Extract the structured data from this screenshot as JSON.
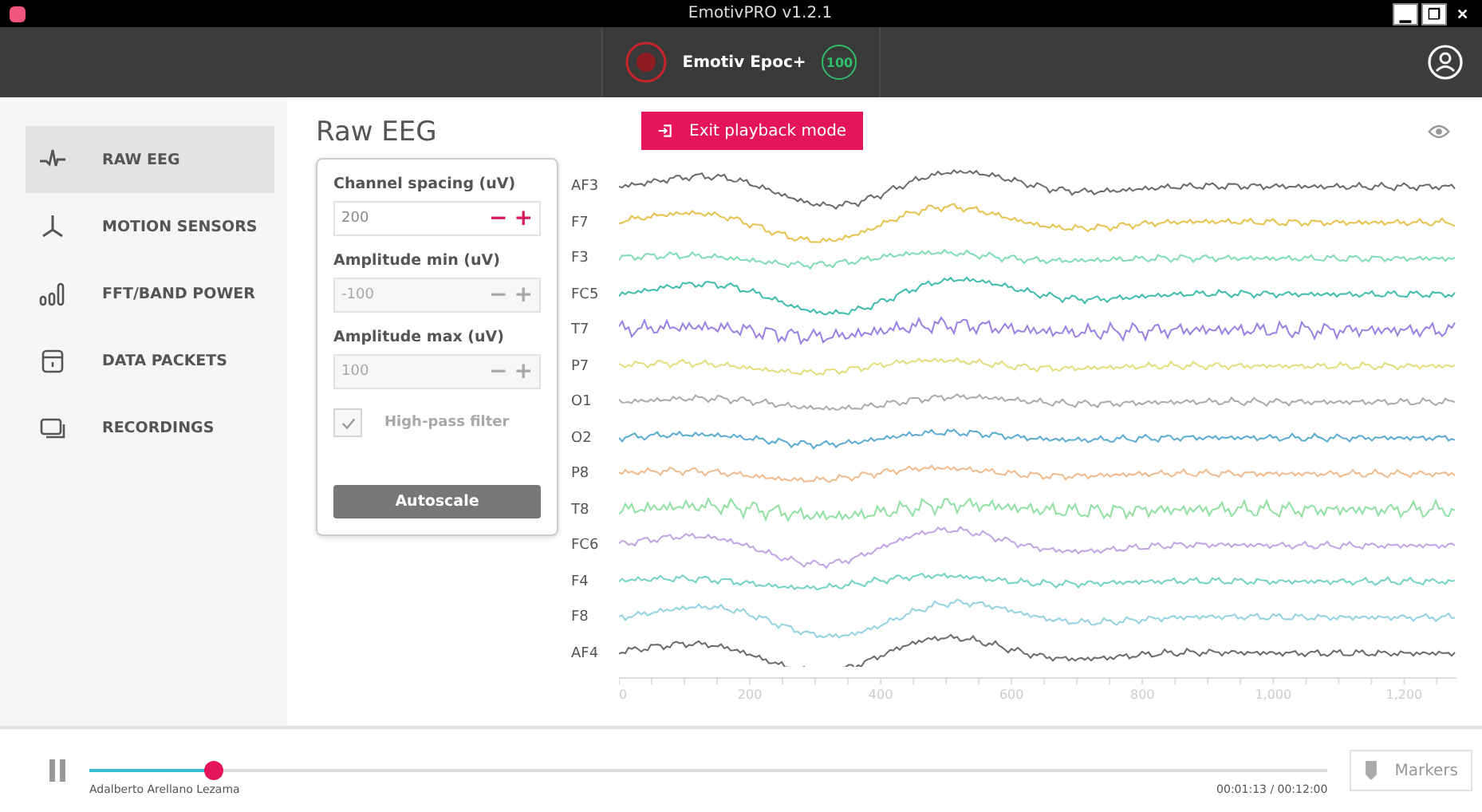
{
  "window": {
    "title": "EmotivPRO v1.2.1",
    "controls": [
      "▁",
      "❐",
      "✕"
    ]
  },
  "header": {
    "device": "Emotiv Epoc+",
    "battery": "100"
  },
  "sidebar": {
    "items": [
      {
        "label": "RAW EEG",
        "selected": true
      },
      {
        "label": "MOTION SENSORS",
        "selected": false
      },
      {
        "label": "FFT/BAND POWER",
        "selected": false
      },
      {
        "label": "DATA PACKETS",
        "selected": false
      },
      {
        "label": "RECORDINGS",
        "selected": false
      }
    ]
  },
  "page_title": "Raw EEG",
  "settings": {
    "fields": [
      {
        "label": "Channel spacing (uV)",
        "value": "200",
        "disabled": false,
        "minus": "−",
        "plus": "+"
      },
      {
        "label": "Amplitude min (uV)",
        "value": "-100",
        "disabled": true,
        "minus": "−",
        "plus": "+"
      },
      {
        "label": "Amplitude max (uV)",
        "value": "100",
        "disabled": true,
        "minus": "−",
        "plus": "+"
      }
    ],
    "high_pass": {
      "label": "High-pass filter",
      "checked": true,
      "disabled": true
    },
    "autoscale": "Autoscale"
  },
  "exit_button": "Exit playback mode",
  "channels": [
    {
      "name": "AF3",
      "color": "#6a6a6a"
    },
    {
      "name": "F7",
      "color": "#e6c24c"
    },
    {
      "name": "F3",
      "color": "#80dcb4"
    },
    {
      "name": "FC5",
      "color": "#3fbcae"
    },
    {
      "name": "T7",
      "color": "#9a80e2"
    },
    {
      "name": "P7",
      "color": "#e4dd7c"
    },
    {
      "name": "O1",
      "color": "#ababab"
    },
    {
      "name": "O2",
      "color": "#5aaad2"
    },
    {
      "name": "P8",
      "color": "#f0ba8c"
    },
    {
      "name": "T8",
      "color": "#90e0a2"
    },
    {
      "name": "FC6",
      "color": "#c2a4e4"
    },
    {
      "name": "F4",
      "color": "#72d2c4"
    },
    {
      "name": "F8",
      "color": "#92d2e2"
    },
    {
      "name": "AF4",
      "color": "#6a6a6a"
    }
  ],
  "x_ticks": [
    "0",
    "200",
    "400",
    "600",
    "800",
    "1,000",
    "1,200"
  ],
  "playback": {
    "level": 0.1,
    "user": "Adalberto Arellano Lezama",
    "time": "00:01:13 / 00:12:00",
    "markers": "Markers",
    "playing": true
  }
}
